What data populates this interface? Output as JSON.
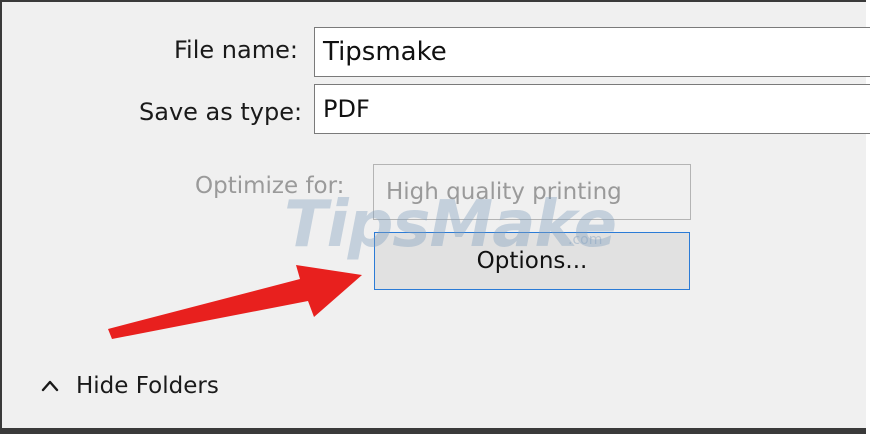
{
  "dialog": {
    "file_name_label": "File name:",
    "file_name_value": "Tipsmake",
    "save_as_type_label": "Save as type:",
    "save_as_type_value": "PDF",
    "optimize_for_label": "Optimize for:",
    "optimize_for_value": "High quality printing",
    "options_button_label": "Options...",
    "hide_folders_label": "Hide Folders"
  },
  "watermark": {
    "brand": "TipsMake",
    "suffix": ".com"
  },
  "annotation": {
    "arrow_color": "#e8201e"
  },
  "icons": {
    "hide_folders": "chevron-up-icon",
    "annotation": "red-arrow-icon"
  }
}
